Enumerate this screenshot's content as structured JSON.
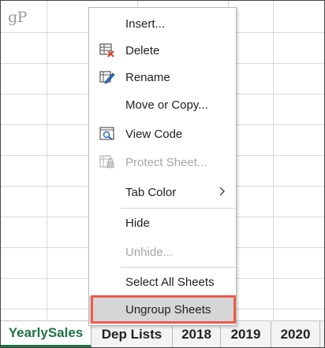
{
  "watermark": "gP",
  "sheet_tabs": [
    "YearlySales",
    "Dep Lists",
    "2018",
    "2019",
    "2020"
  ],
  "context_menu": {
    "items": [
      {
        "label": "Insert...",
        "icon": "none",
        "enabled": true
      },
      {
        "label": "Delete",
        "icon": "delete-sheet-icon",
        "enabled": true
      },
      {
        "label": "Rename",
        "icon": "rename-sheet-icon",
        "enabled": true
      },
      {
        "label": "Move or Copy...",
        "icon": "none",
        "enabled": true
      },
      {
        "label": "View Code",
        "icon": "view-code-icon",
        "enabled": true
      },
      {
        "label": "Protect Sheet...",
        "icon": "protect-sheet-icon",
        "enabled": false
      },
      {
        "label": "Tab Color",
        "icon": "submenu-arrow",
        "enabled": true
      },
      {
        "label": "Hide",
        "icon": "none",
        "enabled": true
      },
      {
        "label": "Unhide...",
        "icon": "none",
        "enabled": false
      },
      {
        "label": "Select All Sheets",
        "icon": "none",
        "enabled": true
      },
      {
        "label": "Ungroup Sheets",
        "icon": "none",
        "enabled": true,
        "highlighted": true
      }
    ]
  },
  "colors": {
    "active_tab_text": "#207245",
    "highlight_border": "#ef5a4b",
    "disabled_text": "#a6a6a6"
  }
}
